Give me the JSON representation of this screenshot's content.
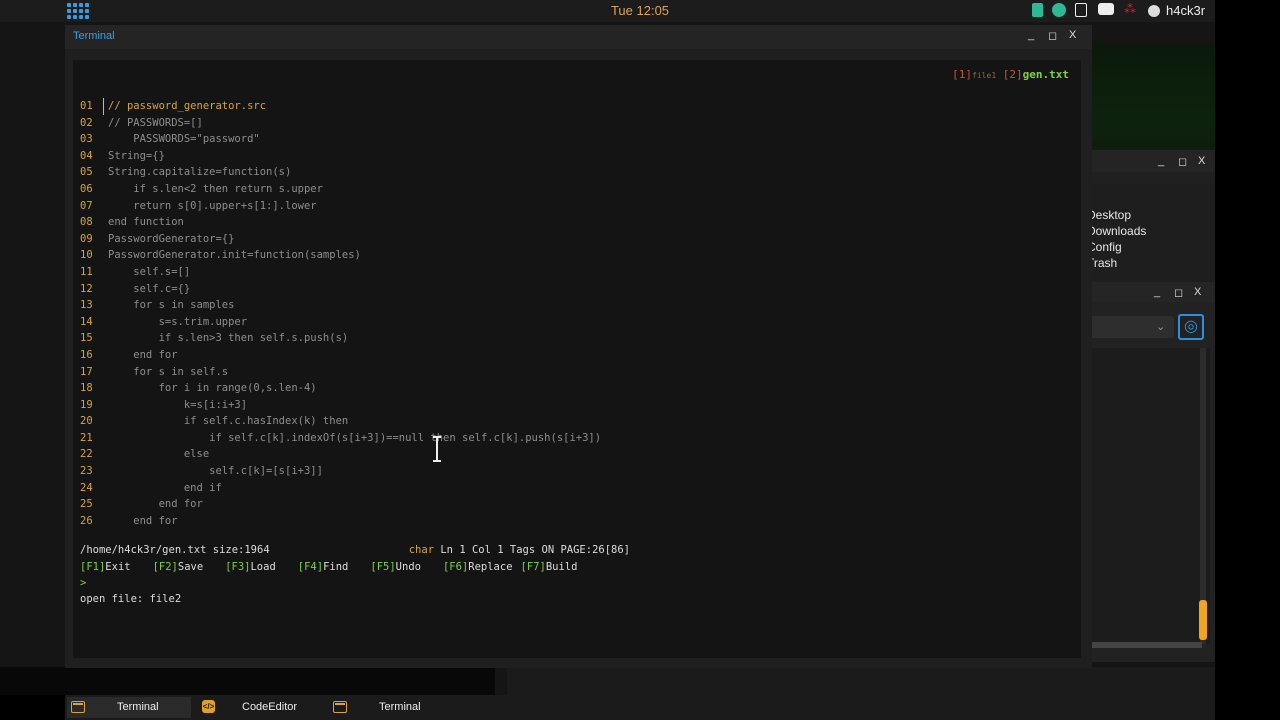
{
  "top_panel": {
    "clock": "Tue 12:05",
    "username": "h4ck3r"
  },
  "terminal": {
    "title": "Terminal",
    "buttons": {
      "minimize": "_",
      "maximize": "◻",
      "close": "X"
    },
    "file_tabs": {
      "tab1_num": "[1]",
      "tab1_name": "file1",
      "tab2_num": "[2]",
      "tab2_name": "gen.txt"
    },
    "code_lines": [
      {
        "n": "01",
        "text": "// password_generator.src"
      },
      {
        "n": "02",
        "text": "// PASSWORDS=[]"
      },
      {
        "n": "03",
        "text": "    PASSWORDS=\"password\""
      },
      {
        "n": "04",
        "text": "String={}"
      },
      {
        "n": "05",
        "text": "String.capitalize=function(s)"
      },
      {
        "n": "06",
        "text": "    if s.len<2 then return s.upper"
      },
      {
        "n": "07",
        "text": "    return s[0].upper+s[1:].lower"
      },
      {
        "n": "08",
        "text": "end function"
      },
      {
        "n": "09",
        "text": "PasswordGenerator={}"
      },
      {
        "n": "10",
        "text": "PasswordGenerator.init=function(samples)"
      },
      {
        "n": "11",
        "text": "    self.s=[]"
      },
      {
        "n": "12",
        "text": "    self.c={}"
      },
      {
        "n": "13",
        "text": "    for s in samples"
      },
      {
        "n": "14",
        "text": "        s=s.trim.upper"
      },
      {
        "n": "15",
        "text": "        if s.len>3 then self.s.push(s)"
      },
      {
        "n": "16",
        "text": "    end for"
      },
      {
        "n": "17",
        "text": "    for s in self.s"
      },
      {
        "n": "18",
        "text": "        for i in range(0,s.len-4)"
      },
      {
        "n": "19",
        "text": "            k=s[i:i+3]"
      },
      {
        "n": "20",
        "text": "            if self.c.hasIndex(k) then"
      },
      {
        "n": "21",
        "text": "                if self.c[k].indexOf(s[i+3])==null then self.c[k].push(s[i+3])"
      },
      {
        "n": "22",
        "text": "            else"
      },
      {
        "n": "23",
        "text": "                self.c[k]=[s[i+3]]"
      },
      {
        "n": "24",
        "text": "            end if"
      },
      {
        "n": "25",
        "text": "        end for"
      },
      {
        "n": "26",
        "text": "    end for"
      }
    ],
    "status": {
      "path": "/home/h4ck3r/gen.txt size:1964",
      "mode": "char",
      "position": "Ln 1 Col 1 Tags ON PAGE:26[86]"
    },
    "function_keys": [
      {
        "key": "[F1]",
        "label": "Exit"
      },
      {
        "key": "[F2]",
        "label": "Save"
      },
      {
        "key": "[F3]",
        "label": "Load"
      },
      {
        "key": "[F4]",
        "label": "Find"
      },
      {
        "key": "[F5]",
        "label": "Undo"
      },
      {
        "key": "[F6]",
        "label": "Replace"
      },
      {
        "key": "[F7]",
        "label": "Build"
      }
    ],
    "prompt": ">",
    "command_output": "open file: file2"
  },
  "file_manager": {
    "buttons": {
      "minimize": "_",
      "maximize": "◻",
      "close": "X"
    },
    "items": [
      "Desktop",
      "Downloads",
      "Config",
      "Trash"
    ]
  },
  "window3": {
    "buttons": {
      "minimize": "_",
      "maximize": "◻",
      "close": "X"
    }
  },
  "taskbar": {
    "items": [
      {
        "label": "Terminal",
        "icon": "terminal-icon"
      },
      {
        "label": "CodeEditor",
        "icon": "code-editor-icon"
      },
      {
        "label": "Terminal",
        "icon": "terminal-icon"
      }
    ]
  },
  "colors": {
    "accent_blue": "#3ba0e6",
    "code_orange": "#d7a540",
    "key_green": "#7fd04a",
    "code_gray": "#8e8e8e"
  }
}
